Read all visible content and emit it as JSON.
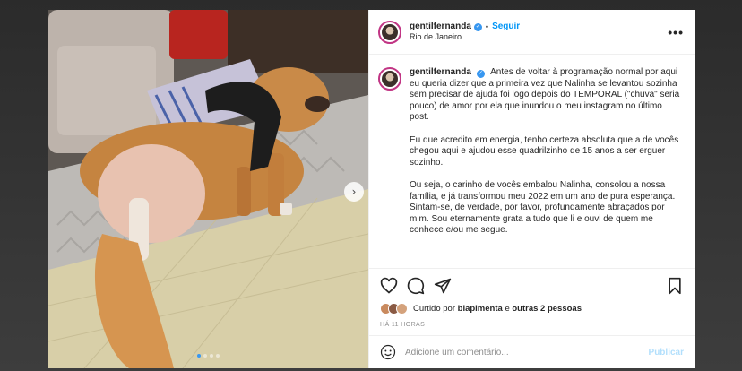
{
  "post": {
    "username": "gentilfernanda",
    "follow_label": "Seguir",
    "separator": "•",
    "location": "Rio de Janeiro",
    "more_label": "•••",
    "caption_paragraphs": [
      "Antes de voltar à programação normal por aqui eu queria dizer que a primeira vez que Nalinha se levantou sozinha sem precisar de ajuda foi logo depois do TEMPORAL (\"chuva\" seria pouco) de amor por ela que inundou o meu instagram no último post.",
      "Eu que acredito em energia, tenho certeza absoluta que a de vocês chegou aqui e ajudou esse quadrilzinho de 15 anos a ser erguer sozinho.",
      "Ou seja, o carinho de vocês embalou Nalinha, consolou a nossa família, e já transformou meu 2022 em um ano de pura esperança. Sintam-se, de verdade, por favor, profundamente abraçados por mim. Sou eternamente grata a tudo que li e ouvi de quem me conhece e/ou me segue."
    ],
    "likes": {
      "prefix": "Curtido por",
      "liker": "biapimenta",
      "connector": "e",
      "others": "outras 2 pessoas"
    },
    "time_label": "HÁ 11 HORAS",
    "comment_placeholder": "Adicione um comentário...",
    "publish_label": "Publicar",
    "carousel": {
      "total": 4,
      "active": 1
    }
  },
  "icons": [
    "heart-icon",
    "comment-icon",
    "share-icon",
    "save-icon",
    "emoji-icon",
    "verified-icon",
    "chevron-right-icon"
  ],
  "colors": {
    "accent": "#0095f6",
    "verified": "#3897f0",
    "publish_disabled": "#b2dffc",
    "muted": "#8e8e8e",
    "text": "#262626"
  }
}
